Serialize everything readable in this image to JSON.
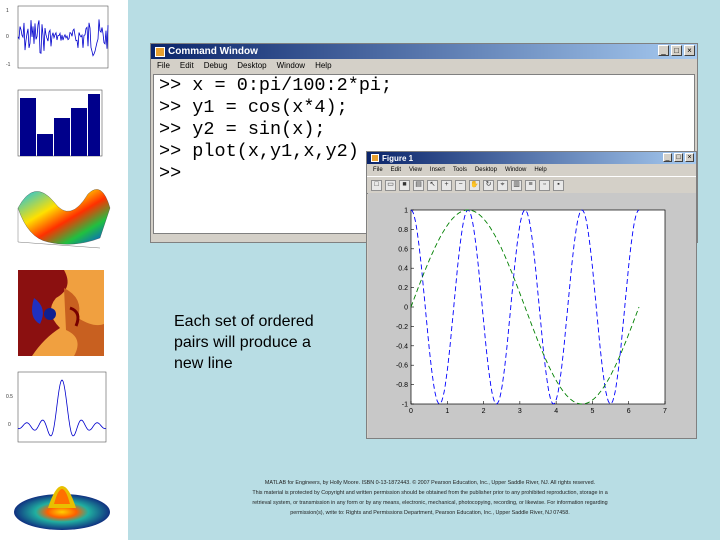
{
  "command_window": {
    "title": "Command Window",
    "menu": [
      "File",
      "Edit",
      "Debug",
      "Desktop",
      "Window",
      "Help"
    ],
    "lines": [
      ">> x = 0:pi/100:2*pi;",
      ">> y1 = cos(x*4);",
      ">> y2 = sin(x);",
      ">> plot(x,y1,x,y2)",
      ">>"
    ],
    "buttons": [
      "_",
      "□",
      "×"
    ]
  },
  "figure_window": {
    "title": "Figure 1",
    "menu": [
      "File",
      "Edit",
      "View",
      "Insert",
      "Tools",
      "Desktop",
      "Window",
      "Help"
    ],
    "toolbar_icons": [
      "new-icon",
      "open-icon",
      "save-icon",
      "print-icon",
      "arrow-icon",
      "zoom-in-icon",
      "zoom-out-icon",
      "pan-icon",
      "rotate-icon",
      "datacursor-icon",
      "colorbar-icon",
      "legend-icon",
      "hide-icon",
      "show-icon"
    ],
    "buttons": [
      "_",
      "□",
      "×"
    ]
  },
  "chart_data": {
    "type": "line",
    "xlim": [
      0,
      7
    ],
    "ylim": [
      -1,
      1
    ],
    "xticks": [
      "0",
      "1",
      "2",
      "3",
      "4",
      "5",
      "6",
      "7"
    ],
    "yticks": [
      "1",
      "0.8",
      "0.6",
      "0.4",
      "0.2",
      "0",
      "-0.2",
      "-0.4",
      "-0.6",
      "-0.8",
      "-1"
    ],
    "series": [
      {
        "function": "y1 = cos(x*4)",
        "color": "#0000ff",
        "style": "dashed"
      },
      {
        "function": "y2 = sin(x)",
        "color": "#008000",
        "style": "dashed"
      }
    ],
    "x_range": [
      0,
      6.2832
    ],
    "grid": false
  },
  "caption": "Each set of ordered pairs will produce a new line",
  "footer": [
    "MATLAB for Engineers, by Holly Moore. ISBN 0-13-1872443. © 2007 Pearson Education, Inc., Upper Saddle River, NJ. All rights reserved.",
    "This material is protected by Copyright and written permission should be obtained from the publisher prior to any prohibited reproduction, storage in a",
    "retrieval system, or transmission in any form or by any means, electronic, mechanical, photocopying, recording, or likewise. For information regarding",
    "permission(s), write to: Rights and Permissions Department, Pearson Education, Inc., Upper Saddle River, NJ 07458."
  ],
  "sidebar_thumbnails": [
    "signal-plot",
    "bar-histogram",
    "surface-plot",
    "fractal-image",
    "sinc-line-plot",
    "3d-surface-peak"
  ]
}
